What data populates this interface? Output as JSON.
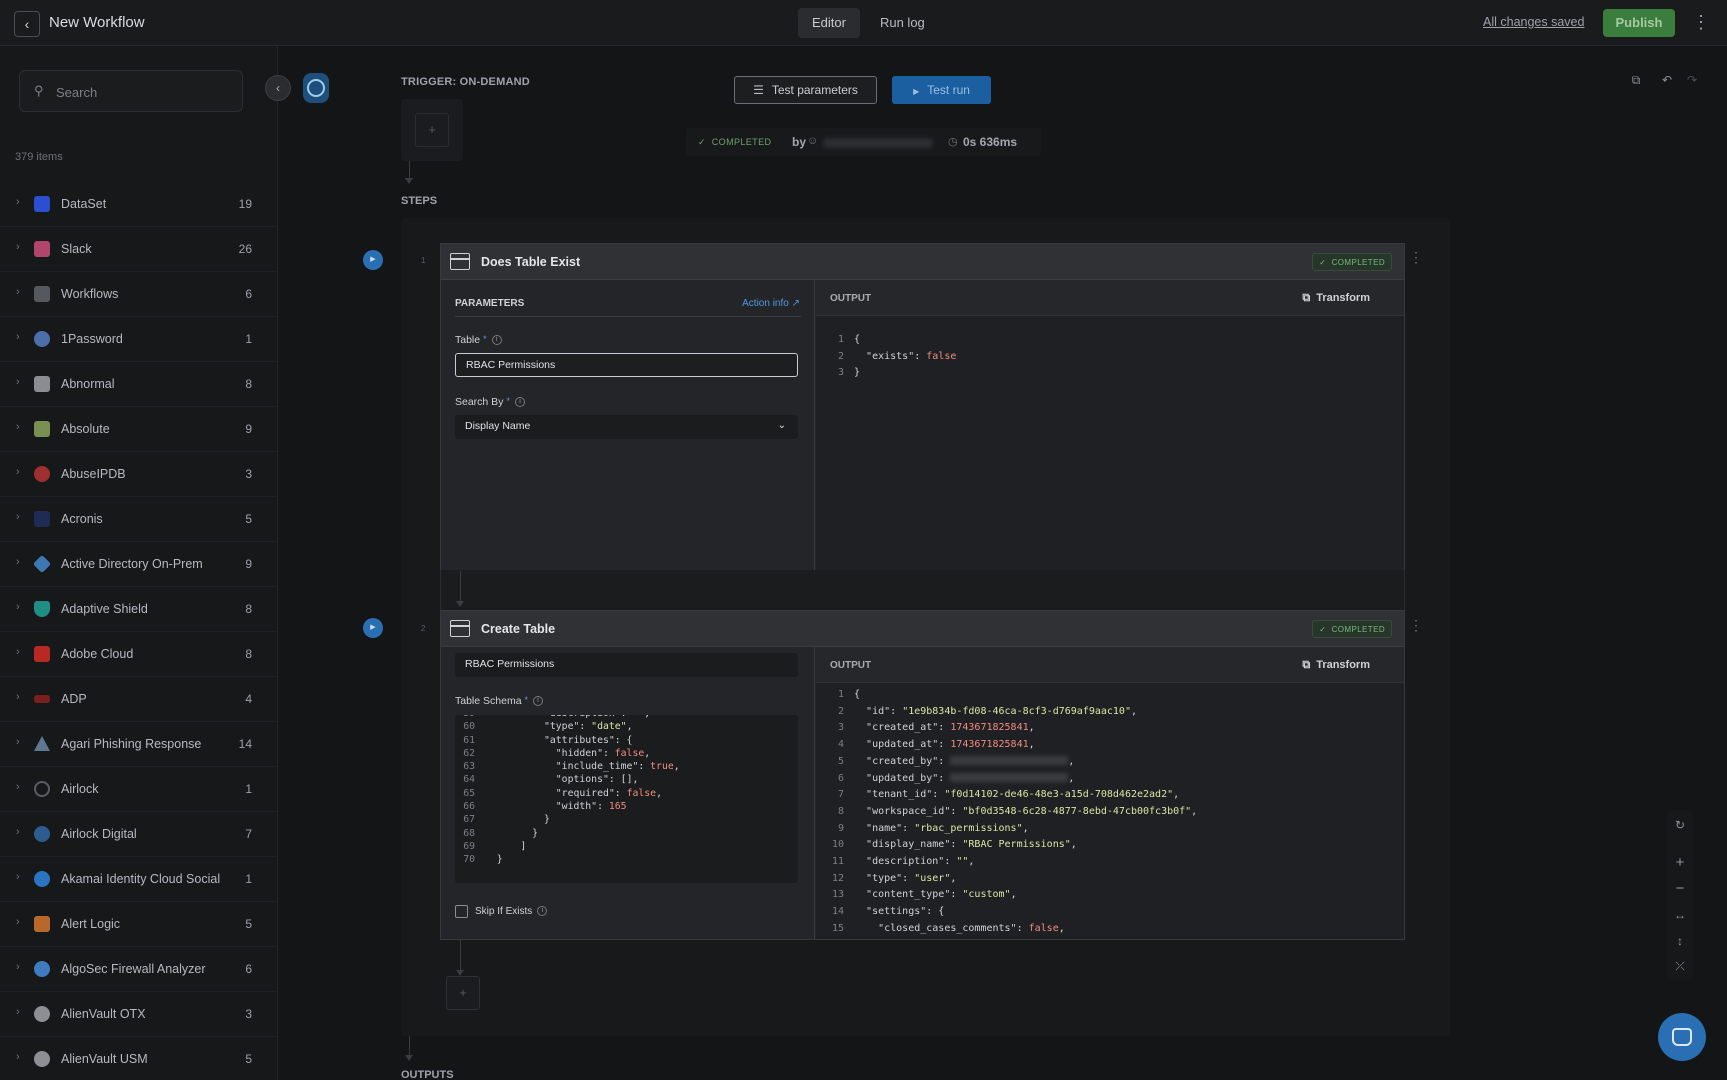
{
  "header": {
    "back_icon": "arrow-left-icon",
    "title": "New Workflow",
    "tabs": [
      {
        "label": "Editor"
      },
      {
        "label": "Run log"
      }
    ],
    "saved": "All changes saved",
    "publish": "Publish"
  },
  "sidebar": {
    "search_placeholder": "Search",
    "count": "379 items",
    "items": [
      {
        "name": "DataSet",
        "count": "19",
        "color": "#2b4fd1"
      },
      {
        "name": "Slack",
        "count": "26",
        "color": "#b2456b"
      },
      {
        "name": "Workflows",
        "count": "6",
        "color": "#55595f"
      },
      {
        "name": "1Password",
        "count": "1",
        "color": "#4b6fa8"
      },
      {
        "name": "Abnormal",
        "count": "8",
        "color": "#8a8d92"
      },
      {
        "name": "Absolute",
        "count": "9",
        "color": "#7a8f52"
      },
      {
        "name": "AbuseIPDB",
        "count": "3",
        "color": "#a03030"
      },
      {
        "name": "Acronis",
        "count": "5",
        "color": "#1e2c55"
      },
      {
        "name": "Active Directory On-Prem",
        "count": "9",
        "color": "#3e78b4"
      },
      {
        "name": "Adaptive Shield",
        "count": "8",
        "color": "#1f8f86"
      },
      {
        "name": "Adobe Cloud",
        "count": "8",
        "color": "#b72a24"
      },
      {
        "name": "ADP",
        "count": "4",
        "color": "#7a1e1e"
      },
      {
        "name": "Agari Phishing Response",
        "count": "14",
        "color": "#5f7890"
      },
      {
        "name": "Airlock",
        "count": "1",
        "color": "#5a5e64"
      },
      {
        "name": "Airlock Digital",
        "count": "7",
        "color": "#2d5c8f"
      },
      {
        "name": "Akamai Identity Cloud Social",
        "count": "1",
        "color": "#2b74c2"
      },
      {
        "name": "Alert Logic",
        "count": "5",
        "color": "#b8692a"
      },
      {
        "name": "AlgoSec Firewall Analyzer",
        "count": "6",
        "color": "#3d7cbf"
      },
      {
        "name": "AlienVault OTX",
        "count": "3",
        "color": "#8c8f94"
      },
      {
        "name": "AlienVault USM",
        "count": "5",
        "color": "#8c8f94"
      }
    ]
  },
  "canvas": {
    "trigger_label": "TRIGGER: ON-DEMAND",
    "test_parameters": "Test parameters",
    "test_run": "Test run",
    "run_status": "COMPLETED",
    "run_by": "by",
    "run_duration": "0s 636ms",
    "steps_label": "STEPS",
    "outputs_label": "OUTPUTS",
    "steps": [
      {
        "num": "1",
        "title": "Does Table Exist",
        "status": "COMPLETED",
        "params_label": "PARAMETERS",
        "action_info": "Action info",
        "table_label": "Table",
        "table_value": "RBAC Permissions",
        "search_by_label": "Search By",
        "search_by_value": "Display Name",
        "output_label": "OUTPUT",
        "transform": "Transform"
      },
      {
        "num": "2",
        "title": "Create Table",
        "status": "COMPLETED",
        "name_value": "RBAC Permissions",
        "schema_label": "Table Schema",
        "skip_label": "Skip If Exists",
        "output_label": "OUTPUT",
        "transform": "Transform"
      }
    ]
  }
}
